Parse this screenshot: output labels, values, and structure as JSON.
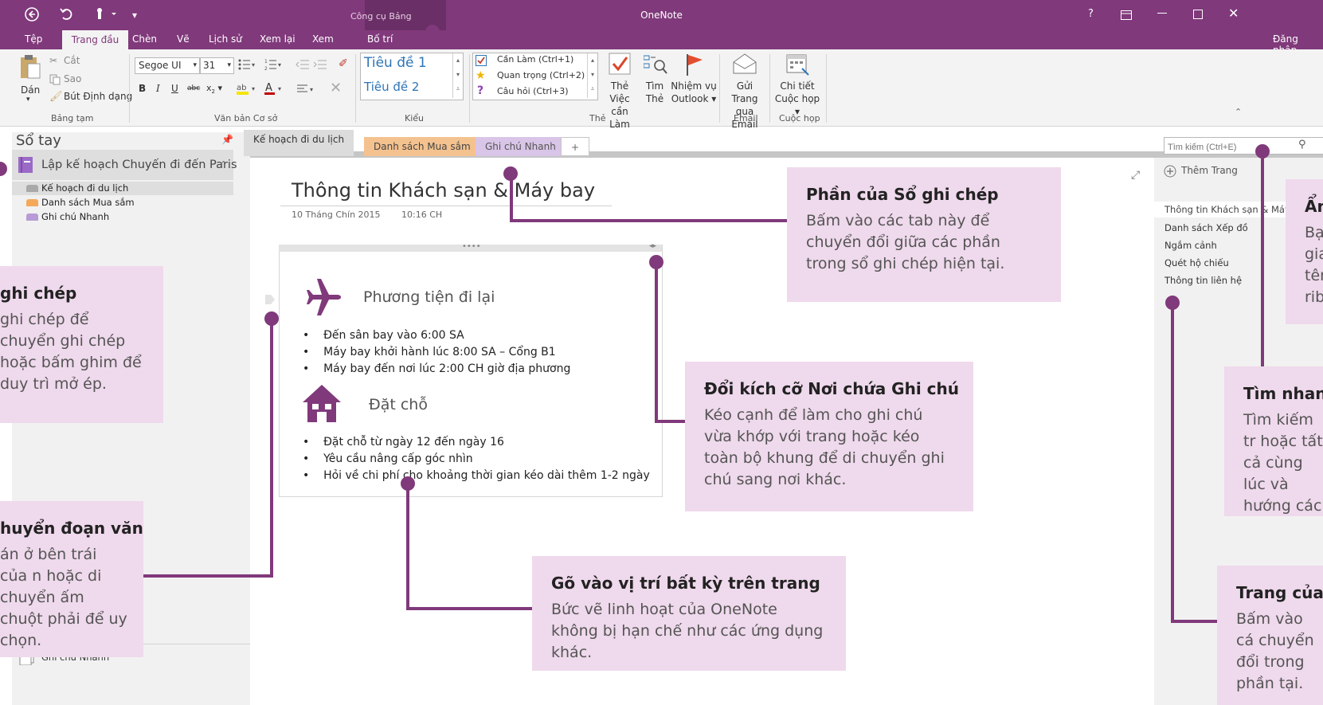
{
  "window": {
    "app_title": "OneNote",
    "context_group": "Công cụ Bảng",
    "signin": "Đăng nhập",
    "help": "?"
  },
  "ribbon_tabs": [
    "Tệp",
    "Trang đầu",
    "Chèn",
    "Vẽ",
    "Lịch sử",
    "Xem lại",
    "Xem",
    "Bố trí"
  ],
  "ribbon": {
    "paste": "Dán",
    "cut": "Cắt",
    "copy": "Sao",
    "format_painter": "Bút Định dạng",
    "clipboard_group": "Bảng tạm",
    "font_name": "Segoe UI",
    "font_size": "31",
    "basic_text_group": "Văn bản Cơ sở",
    "style_h1": "Tiêu đề 1",
    "style_h2": "Tiêu đề 2",
    "styles_group": "Kiểu",
    "tag_todo": "Cần Làm (Ctrl+1)",
    "tag_important": "Quan trọng (Ctrl+2)",
    "tag_question": "Câu hỏi (Ctrl+3)",
    "todo_tag_line1": "Thẻ Việc",
    "todo_tag_line2": "cần Làm",
    "find_line1": "Tìm",
    "find_line2": "Thẻ",
    "outlook_line1": "Nhiệm vụ",
    "outlook_line2": "Outlook",
    "tags_group": "Thẻ",
    "email_line1": "Gửi Trang",
    "email_line2": "qua Email",
    "email_group": "Email",
    "meeting_line1": "Chi tiết",
    "meeting_line2": "Cuộc họp",
    "meetings_group": "Cuộc họp"
  },
  "notebook_pane": {
    "header": "Sổ tay",
    "notebook": "Lập kế hoạch Chuyến đi đến Paris",
    "sections": [
      "Kế hoạch đi du lịch",
      "Danh sách Mua sắm",
      "Ghi chú Nhanh"
    ],
    "quick_notes": "Ghi chú Nhanh"
  },
  "section_tabs": [
    "Kế hoạch đi du lịch",
    "Danh sách Mua sắm",
    "Ghi chú Nhanh",
    "+"
  ],
  "page": {
    "title": "Thông tin Khách sạn & Máy bay",
    "date": "10 Tháng Chín 2015",
    "time": "10:16 CH",
    "transport_heading": "Phương tiện đi lại",
    "transport_items": [
      "Đến sân bay vào 6:00 SA",
      "Máy bay khởi hành lúc 8:00 SA – Cổng B1",
      "Máy bay đến nơi lúc 2:00 CH giờ địa phương"
    ],
    "booking_heading": "Đặt chỗ",
    "booking_items": [
      "Đặt chỗ từ ngày 12 đến ngày 16",
      "Yêu cầu nâng cấp góc nhìn",
      "Hỏi về chi phí cho khoảng thời gian kéo dài thêm 1-2 ngày"
    ]
  },
  "search": {
    "placeholder": "Tìm kiếm (Ctrl+E)"
  },
  "pages_pane": {
    "add_page": "Thêm Trang",
    "pages": [
      "Thông tin Khách sạn & Máy",
      "Danh sách Xếp đồ",
      "Ngắm cảnh",
      "Quét hộ chiếu",
      "Thông tin liên hệ"
    ]
  },
  "callouts": {
    "sections": {
      "title": "Phần của Sổ ghi chép",
      "body": "Bấm vào các tab này để chuyển đổi giữa các phần trong sổ ghi chép hiện tại."
    },
    "resize": {
      "title": "Đổi kích cỡ Nơi chứa Ghi chú",
      "body": "Kéo cạnh để làm cho ghi chú vừa khớp với trang hoặc kéo toàn bộ khung để di chuyển ghi chú sang nơi khác."
    },
    "type_anywhere": {
      "title": "Gõ vào vị trí bất kỳ trên trang",
      "body": "Bức vẽ linh hoạt của OneNote không bị hạn chế như các ứng dụng khác."
    },
    "notebooks_partial": {
      "title": "ghi chép",
      "body": "ghi chép để chuyển ghi chép hoặc bấm ghim để duy trì mở ép."
    },
    "move_para_partial": {
      "title": "huyển đoạn văn",
      "body": "án ở bên trái của n hoặc di chuyển ấm chuột phải để uy chọn."
    },
    "hide_partial": {
      "title": "Ẩn",
      "body": "Bạ gia tên rib"
    },
    "search_partial": {
      "title": "Tìm nhanh",
      "body": "Tìm kiếm tr hoặc tất cả cùng lúc và hướng các"
    },
    "pages_partial": {
      "title": "Trang của S",
      "body": "Bấm vào cá chuyển đổi trong phần tại."
    }
  },
  "colors": {
    "brand": "#80397b",
    "callout_bg": "#efd9ec",
    "tab_travel": "#dcdcdc",
    "tab_shopping": "#f4c28f",
    "tab_quick": "#d9c5e7"
  }
}
